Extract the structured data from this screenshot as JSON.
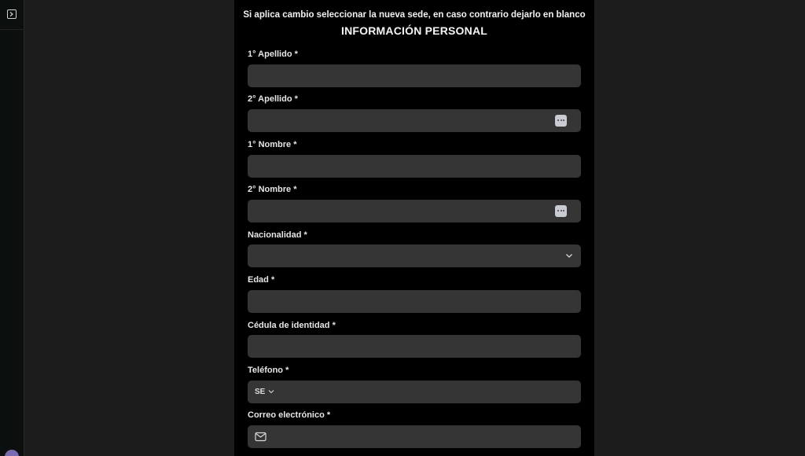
{
  "notice": "Si aplica cambio seleccionar la nueva sede, en caso contrario dejarlo en blanco",
  "section_title": "INFORMACIÓN PERSONAL",
  "fields": {
    "primer_apellido": {
      "label": "1° Apellido *",
      "value": ""
    },
    "segundo_apellido": {
      "label": "2° Apellido *",
      "value": ""
    },
    "primer_nombre": {
      "label": "1° Nombre *",
      "value": ""
    },
    "segundo_nombre": {
      "label": "2° Nombre *",
      "value": ""
    },
    "nacionalidad": {
      "label": "Nacionalidad *",
      "value": ""
    },
    "edad": {
      "label": "Edad *",
      "value": ""
    },
    "cedula": {
      "label": "Cédula de identidad *",
      "value": ""
    },
    "telefono": {
      "label": "Teléfono *",
      "country_code": "SE",
      "value": ""
    },
    "correo": {
      "label": "Correo electrónico *",
      "value": ""
    }
  },
  "icons": {
    "sidebar_toggle": "sidebar-toggle-icon",
    "password_manager": "password-manager-icon",
    "dropdown": "chevron-down-icon",
    "email": "mail-icon"
  },
  "colors": {
    "page_background": "#1c1c1c",
    "panel_background": "#000000",
    "field_background": "#353535",
    "avatar": "#7a6bb0"
  }
}
